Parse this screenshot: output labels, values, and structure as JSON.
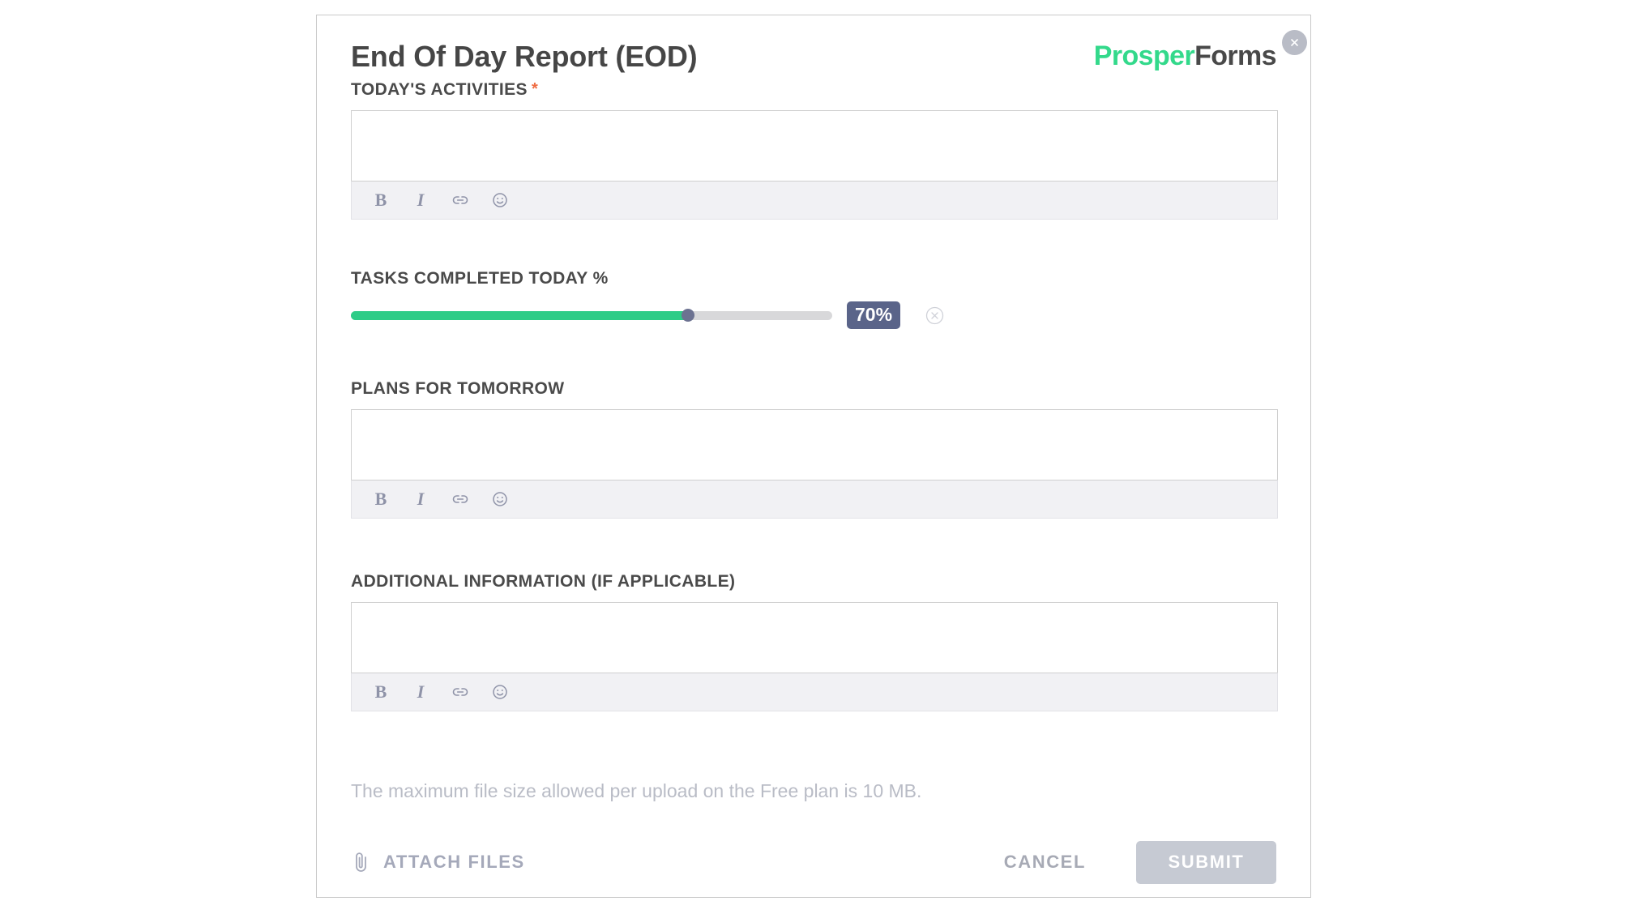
{
  "dialog": {
    "title": "End Of Day Report (EOD)",
    "close_label": "×"
  },
  "brand": {
    "part1": "Prosper",
    "part2": "Forms",
    "color1": "#33d98b",
    "color2": "#494949"
  },
  "fields": [
    {
      "label": "TODAY'S ACTIVITIES",
      "required": true,
      "required_marker": "*",
      "type": "richtext",
      "value": "",
      "placeholder": ""
    },
    {
      "label": "TASKS COMPLETED TODAY %",
      "required": false,
      "type": "slider",
      "value": 70,
      "value_label": "70%",
      "min": 0,
      "max": 100,
      "fill_color": "#2ecc87",
      "track_color": "#d8d8da",
      "badge_color": "#5a6489"
    },
    {
      "label": "PLANS FOR TOMORROW",
      "required": false,
      "type": "richtext",
      "value": "",
      "placeholder": ""
    },
    {
      "label": "ADDITIONAL INFORMATION (IF APPLICABLE)",
      "required": false,
      "type": "richtext",
      "value": "",
      "placeholder": ""
    }
  ],
  "toolbar": {
    "bold_label": "B",
    "italic_label": "I",
    "link_name": "link-icon",
    "emoji_name": "emoji-icon"
  },
  "footer": {
    "file_note": "The maximum file size allowed per upload on the Free plan is 10 MB.",
    "attach_label": "ATTACH FILES",
    "cancel_label": "CANCEL",
    "submit_label": "SUBMIT",
    "submit_disabled": true
  }
}
